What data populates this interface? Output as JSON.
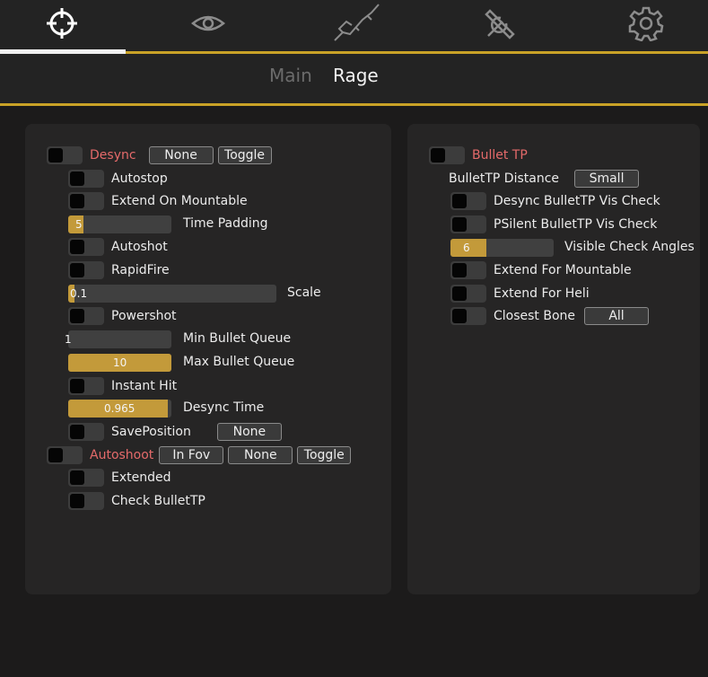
{
  "tabs": {
    "icons": [
      "crosshair-icon",
      "eye-icon",
      "rifle-icon",
      "tools-icon",
      "gear-icon"
    ],
    "active_index": 0
  },
  "subtabs": {
    "main": "Main",
    "rage": "Rage",
    "active": "Rage"
  },
  "colors": {
    "accent": "#c9a227",
    "slider_fill": "#c39a3a",
    "warning_label": "#e46a6a",
    "panel": "#262525"
  },
  "left": {
    "desync": {
      "label": "Desync",
      "key": "None",
      "mode": "Toggle"
    },
    "autostop": "Autostop",
    "extend_on_mountable": "Extend On Mountable",
    "time_padding": {
      "label": "Time Padding",
      "value": "5",
      "fill": 0.15
    },
    "autoshot": "Autoshot",
    "rapidfire": "RapidFire",
    "scale": {
      "label": "Scale",
      "value": "0.1",
      "fill": 0.03
    },
    "powershot": "Powershot",
    "min_bullet_queue": {
      "label": "Min Bullet Queue",
      "value": "1",
      "fill": 0.0
    },
    "max_bullet_queue": {
      "label": "Max Bullet Queue",
      "value": "10",
      "fill": 1.0
    },
    "instant_hit": "Instant Hit",
    "desync_time": {
      "label": "Desync Time",
      "value": "0.965",
      "fill": 0.965
    },
    "save_position": {
      "label": "SavePosition",
      "key": "None"
    },
    "autoshoot": {
      "label": "Autoshoot",
      "mode1": "In Fov",
      "key": "None",
      "mode2": "Toggle"
    },
    "extended": "Extended",
    "check_bullettp": "Check BulletTP"
  },
  "right": {
    "bullet_tp": "Bullet TP",
    "bullettp_distance": {
      "label": "BulletTP Distance",
      "value": "Small"
    },
    "desync_vis_check": "Desync BulletTP Vis Check",
    "psilent_vis_check": "PSilent BulletTP Vis Check",
    "visible_check_angles": {
      "label": "Visible Check Angles",
      "value": "6",
      "fill": 0.35
    },
    "extend_for_mountable": "Extend For Mountable",
    "extend_for_heli": "Extend For Heli",
    "closest_bone": {
      "label": "Closest Bone",
      "value": "All"
    }
  }
}
